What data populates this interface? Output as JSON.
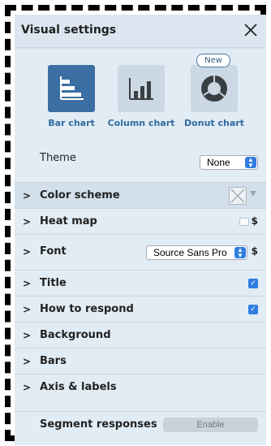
{
  "header": {
    "title": "Visual settings"
  },
  "chart_types": [
    {
      "label": "Bar chart",
      "icon": "bar-chart-icon",
      "selected": true
    },
    {
      "label": "Column chart",
      "icon": "column-chart-icon",
      "selected": false
    },
    {
      "label": "Donut chart",
      "icon": "donut-chart-icon",
      "selected": false,
      "badge": "New"
    }
  ],
  "theme": {
    "label": "Theme",
    "value": "None"
  },
  "sections": {
    "color_scheme": "Color scheme",
    "heat_map": "Heat map",
    "font": "Font",
    "font_value": "Source Sans Pro",
    "title": "Title",
    "how_to_respond": "How to respond",
    "background": "Background",
    "bars": "Bars",
    "axis_labels": "Axis & labels"
  },
  "dollar_sign": "$",
  "segment": {
    "label": "Segment responses",
    "button": "Enable"
  },
  "colors": {
    "accent": "#3b6fa3",
    "checkbox": "#2f7de1",
    "panel": "#e2ecf4"
  }
}
